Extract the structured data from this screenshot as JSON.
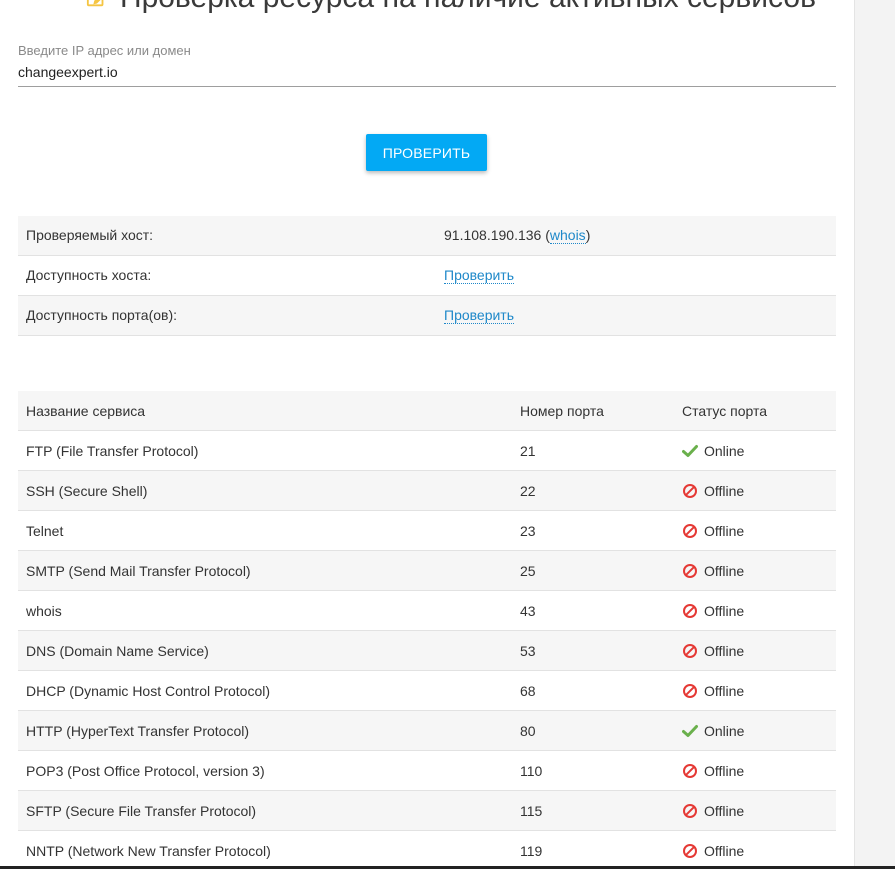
{
  "header": {
    "title": "Проверка ресурса на наличие активных сервисов",
    "icon": "note-pencil-icon",
    "icon_color": "#f5c542"
  },
  "form": {
    "label": "Введите IP адрес или домен",
    "value": "changeexpert.io",
    "button_label": "ПРОВЕРИТЬ",
    "button_color": "#03a9f4"
  },
  "host_info": {
    "rows": [
      {
        "label": "Проверяемый хост:",
        "value": "91.108.190.136",
        "link": "whois"
      },
      {
        "label": "Доступность хоста:",
        "link": "Проверить"
      },
      {
        "label": "Доступность порта(ов):",
        "link": "Проверить"
      }
    ]
  },
  "ports_table": {
    "columns": [
      "Название сервиса",
      "Номер порта",
      "Статус порта"
    ],
    "rows": [
      {
        "service": "FTP (File Transfer Protocol)",
        "port": "21",
        "status": "Online"
      },
      {
        "service": "SSH (Secure Shell)",
        "port": "22",
        "status": "Offline"
      },
      {
        "service": "Telnet",
        "port": "23",
        "status": "Offline"
      },
      {
        "service": "SMTP (Send Mail Transfer Protocol)",
        "port": "25",
        "status": "Offline"
      },
      {
        "service": "whois",
        "port": "43",
        "status": "Offline"
      },
      {
        "service": "DNS (Domain Name Service)",
        "port": "53",
        "status": "Offline"
      },
      {
        "service": "DHCP (Dynamic Host Control Protocol)",
        "port": "68",
        "status": "Offline"
      },
      {
        "service": "HTTP (HyperText Transfer Protocol)",
        "port": "80",
        "status": "Online"
      },
      {
        "service": "POP3 (Post Office Protocol, version 3)",
        "port": "110",
        "status": "Offline"
      },
      {
        "service": "SFTP (Secure File Transfer Protocol)",
        "port": "115",
        "status": "Offline"
      },
      {
        "service": "NNTP (Network New Transfer Protocol)",
        "port": "119",
        "status": "Offline"
      }
    ]
  },
  "status_colors": {
    "online": "#6ab04c",
    "offline": "#e53935"
  },
  "status_icons": {
    "online": "checkmark-icon",
    "offline": "no-entry-icon"
  }
}
